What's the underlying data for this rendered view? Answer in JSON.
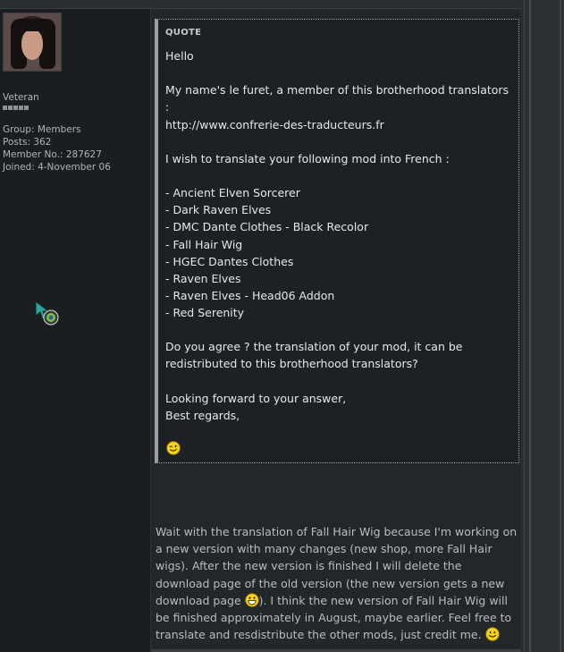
{
  "profile": {
    "rank": "Veteran",
    "group": "Group: Members",
    "posts": "Posts: 362",
    "member_no": "Member No.: 287627",
    "joined": "Joined: 4-November 06"
  },
  "quote": {
    "label": "QUOTE",
    "lines": [
      "Hello",
      "My name's le furet, a member of this brotherhood translators",
      ":",
      "http://www.confrerie-des-traducteurs.fr",
      "I wish to translate your following mod into French :",
      "- Ancient Elven Sorcerer",
      "- Dark Raven Elves",
      "- DMC Dante Clothes - Black Recolor",
      "- Fall Hair Wig",
      "- HGEC Dantes Clothes",
      "- Raven Elves",
      "- Raven Elves - Head06 Addon",
      "- Red Serenity",
      "Do you agree ? the translation of your mod, it can be",
      "redistributed to this brotherhood translators?",
      "Looking forward to your answer,",
      "Best regards,"
    ]
  },
  "reply": {
    "part1": "Wait with the translation of Fall Hair Wig because I'm working on a new version with many changes (new shop, more Fall Hair wigs). After the new version is finished I will delete the download page of the old version (the new version gets a new download page ",
    "part2": "). I think the new version of Fall Hair Wig will be finished approximately in August, maybe earlier. Feel free to translate and resdistribute the other mods, just credit me. "
  },
  "icons": {
    "status": "online-status-icon",
    "wink": "wink-smiley-icon",
    "grin": "grin-smiley-icon",
    "smile": "smile-smiley-icon"
  }
}
